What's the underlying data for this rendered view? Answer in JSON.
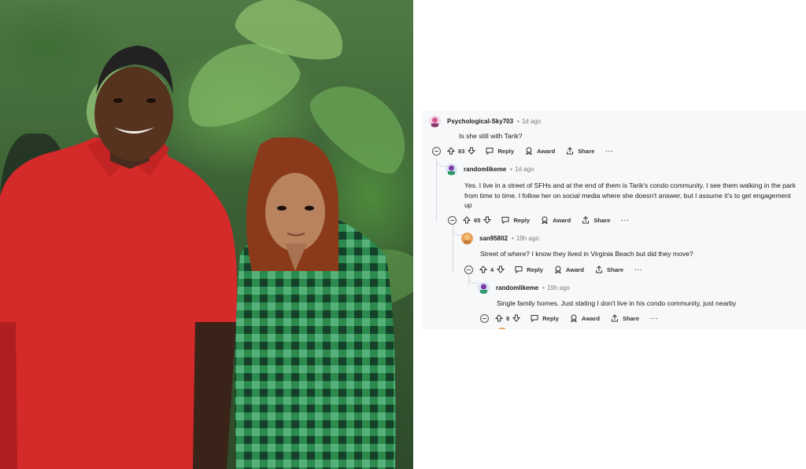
{
  "photo": {
    "description_icon": "photo"
  },
  "thread": {
    "comments": [
      {
        "username": "Psychological-Sky703",
        "time": "1d ago",
        "text": "Is she still with Tarik?",
        "votes": "83"
      },
      {
        "username": "randomlikeme",
        "time": "1d ago",
        "text": "Yes. I live in a street of SFHs and at the end of them is Tarik's condo community. I see them walking in the park from time to time. I follow her on social media where she doesn't answer, but I assume it's to get engagement up",
        "votes": "65"
      },
      {
        "username": "san95802",
        "time": "19h ago",
        "text": "Street of where? I know they lived in Virginia Beach but did they move?",
        "votes": "4"
      },
      {
        "username": "randomlikeme",
        "time": "19h ago",
        "text": "Single family homes. Just stating I don't live in his condo community, just nearby",
        "votes": "8"
      }
    ],
    "labels": {
      "reply": "Reply",
      "award": "Award",
      "share": "Share",
      "more": "···",
      "sep": "•"
    }
  },
  "colors": {
    "background": "#f7f8f9",
    "username": "#1c1c1c",
    "muted": "#7c7c7c",
    "thread_line": "#d4d7da"
  }
}
